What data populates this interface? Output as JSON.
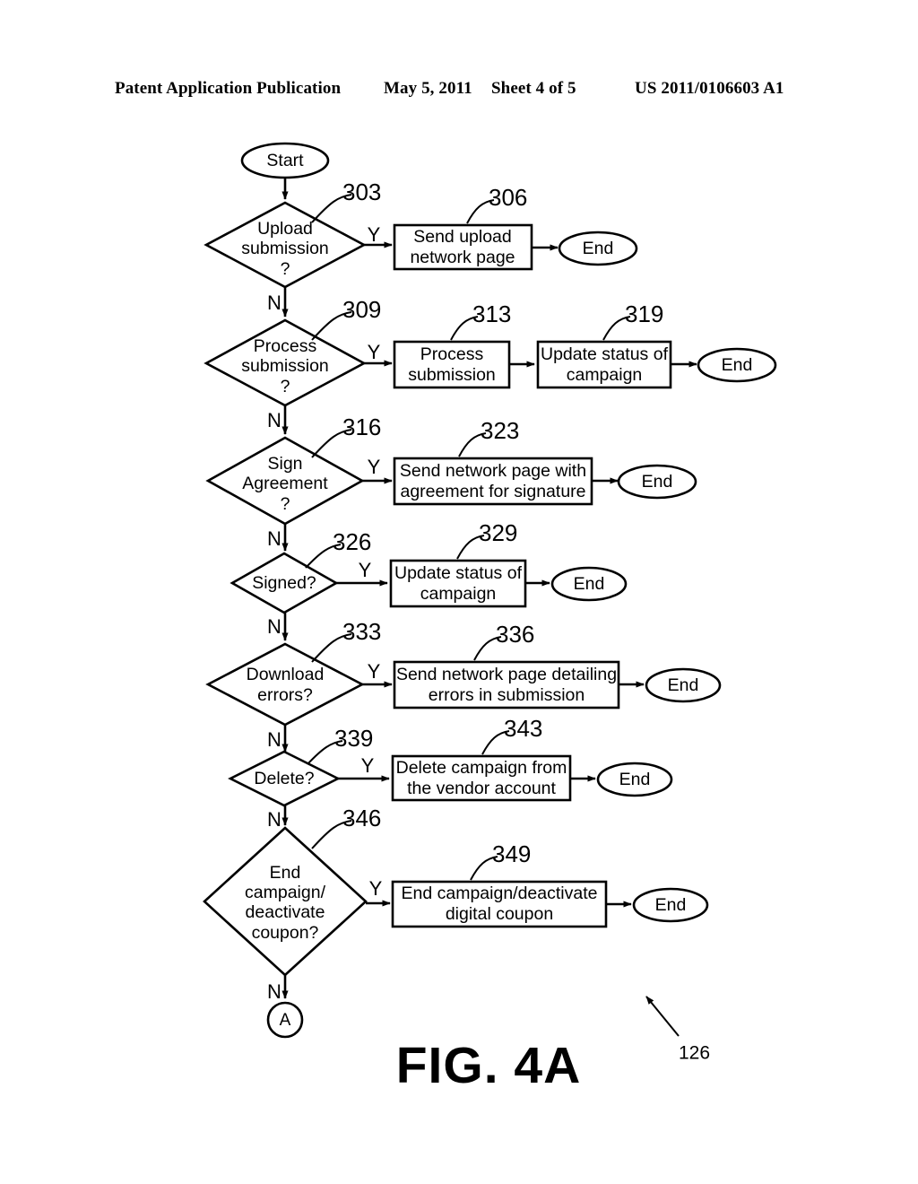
{
  "header": {
    "publication": "Patent Application Publication",
    "date": "May 5, 2011",
    "sheet": "Sheet 4 of 5",
    "number": "US 2011/0106603 A1"
  },
  "figure": {
    "caption": "FIG. 4A",
    "overall_ref": "126"
  },
  "terminals": {
    "start": "Start",
    "connector_a": "A",
    "end": "End"
  },
  "branch_labels": {
    "yes": "Y",
    "no": "N"
  },
  "rows": [
    {
      "decision": {
        "ref": "303",
        "lines": [
          "Upload",
          "submission",
          "?"
        ]
      },
      "actions": [
        {
          "ref": "306",
          "lines": [
            "Send upload",
            "network page"
          ]
        }
      ],
      "end": "End"
    },
    {
      "decision": {
        "ref": "309",
        "lines": [
          "Process",
          "submission",
          "?"
        ]
      },
      "actions": [
        {
          "ref": "313",
          "lines": [
            "Process",
            "submission"
          ]
        },
        {
          "ref": "319",
          "lines": [
            "Update status of",
            "campaign"
          ]
        }
      ],
      "end": "End"
    },
    {
      "decision": {
        "ref": "316",
        "lines": [
          "Sign",
          "Agreement",
          "?"
        ]
      },
      "actions": [
        {
          "ref": "323",
          "lines": [
            "Send network page with",
            "agreement for signature"
          ]
        }
      ],
      "end": "End"
    },
    {
      "decision": {
        "ref": "326",
        "lines": [
          "Signed?"
        ]
      },
      "actions": [
        {
          "ref": "329",
          "lines": [
            "Update status of",
            "campaign"
          ]
        }
      ],
      "end": "End"
    },
    {
      "decision": {
        "ref": "333",
        "lines": [
          "Download",
          "errors?"
        ]
      },
      "actions": [
        {
          "ref": "336",
          "lines": [
            "Send network page detailing",
            "errors in submission"
          ]
        }
      ],
      "end": "End"
    },
    {
      "decision": {
        "ref": "339",
        "lines": [
          "Delete?"
        ]
      },
      "actions": [
        {
          "ref": "343",
          "lines": [
            "Delete campaign from",
            "the vendor account"
          ]
        }
      ],
      "end": "End"
    },
    {
      "decision": {
        "ref": "346",
        "lines": [
          "End",
          "campaign/",
          "deactivate",
          "coupon?"
        ]
      },
      "actions": [
        {
          "ref": "349",
          "lines": [
            "End campaign/deactivate",
            "digital coupon"
          ]
        }
      ],
      "end": "End"
    }
  ]
}
